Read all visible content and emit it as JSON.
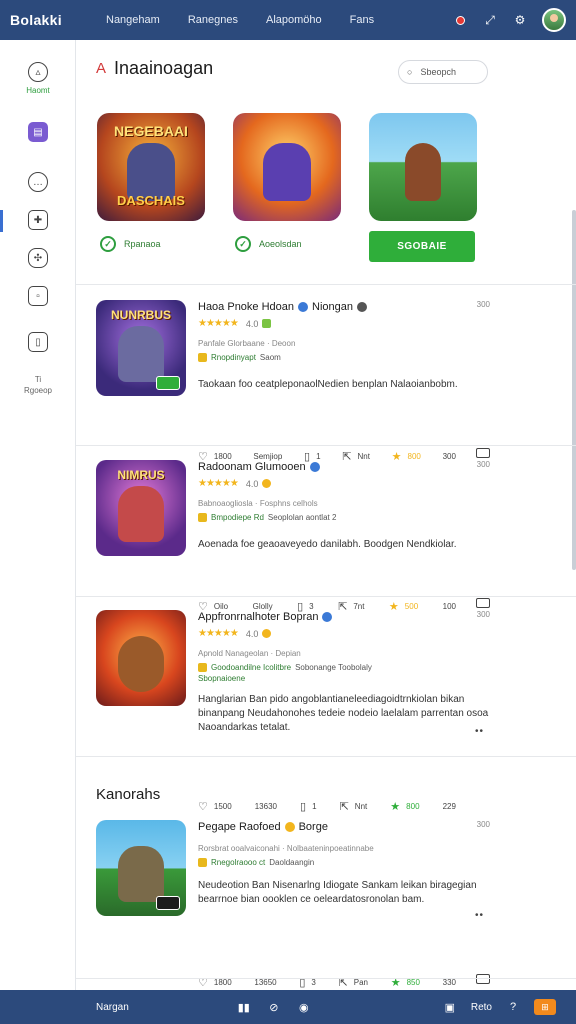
{
  "topbar": {
    "logo": "Bolakki",
    "nav": [
      "Nangeham",
      "Ranegnes",
      "Alapomöho",
      "Fans"
    ],
    "icons": [
      "notification-icon",
      "expand-icon",
      "settings-icon",
      "avatar"
    ]
  },
  "sidebar": {
    "items": [
      {
        "icon": "home-icon",
        "label": "Haomt"
      },
      {
        "icon": "store-icon",
        "label": ""
      },
      {
        "icon": "chat-icon",
        "label": ""
      },
      {
        "icon": "puzzle-icon",
        "label": ""
      },
      {
        "icon": "brain-icon",
        "label": ""
      },
      {
        "icon": "media-icon",
        "label": ""
      },
      {
        "icon": "book-icon",
        "label": ""
      }
    ],
    "bottom_label_1": "Ti",
    "bottom_label_2": "Rgoeop"
  },
  "main": {
    "heading_mark": "A",
    "heading": "Inaainoagan",
    "search_placeholder": "Sbeopch"
  },
  "featured": [
    {
      "title": "NEGEBAAI",
      "title2": "DASCHAIS",
      "status": "Rpanaoa"
    },
    {
      "title": "",
      "title2": "",
      "status": "Aoeolsdan"
    },
    {
      "title": "",
      "title2": "",
      "button": "SGOBAIE"
    }
  ],
  "cards": [
    {
      "title": "Haoa Pnoke Hdoan",
      "title_extra": "Niongan",
      "dots": "300",
      "rating": "★★★★★",
      "rating_text": "4.0",
      "meta": "Panfale Glorbaane  ·  Deoon",
      "meta2": "Rnopdinyapt",
      "meta2_grey": "Saom",
      "desc": "Taokaan foo ceatpleponaolNedien benplan Nalaoianbobm.",
      "thumb_text": "NUNRBUS",
      "actions": [
        "1800",
        "Semjiop",
        "1",
        "Nnt",
        "800",
        "300"
      ]
    },
    {
      "title": "Radoonam Glumooen",
      "title_extra": "",
      "dots": "300",
      "rating": "★★★★★",
      "rating_text": "4.0",
      "meta": "Babnoaogliosla  ·  Fosphns celhols",
      "meta2": "Bmpodiepe Rd",
      "meta2_grey": "Seoplolan aontlat 2",
      "desc": "Aoenada foe geaoaveyedo danilabh. Boodgen Nendkiolar.",
      "thumb_text": "NIMRUS",
      "actions": [
        "Oilo",
        "Glolly",
        "3",
        "7nt",
        "500",
        "100"
      ]
    },
    {
      "title": "Appfronrnalhoter Bopran",
      "title_extra": "",
      "dots": "300",
      "rating": "★★★★★",
      "rating_text": "4.0",
      "meta": "Apnold Nanageolan  ·  Depian",
      "meta2": "Goodoandilne Icolitbre",
      "meta2_grey": "Sobonange Toobolaly",
      "meta3": "Sbopnaioene",
      "desc": "Hanglarian Ban pido angoblantianeleediagoidtrnkiolan bikan binanpang Neudahonohes tedeie nodeio laelalam parrentan osoa Naoandarkas tetalat.",
      "thumb_text": "",
      "actions": [
        "1500",
        "13630",
        "1",
        "Nnt",
        "800",
        "229"
      ]
    },
    {
      "title": "Pegape Raofoed",
      "title_extra": "Borge",
      "dots": "300",
      "rating": "",
      "rating_text": "",
      "meta": "Rorsbrat ooalvaiconahi  ·  Nolbaateninpoeatinnabe",
      "meta2": "Rnegolraooo ct",
      "meta2_grey": "Daoldaangin",
      "desc": "Neudeotion Ban Nisenarlng Idiogate Sankam leikan biragegian bearrnoe bian oooklen ce oeleardatosronolan bam.",
      "thumb_text": "",
      "actions": [
        "1800",
        "13650",
        "3",
        "Pan",
        "850",
        "330"
      ]
    }
  ],
  "section_subtitle": "Kanorahs",
  "bottombar": {
    "label": "Nargan",
    "right_label": "Reto"
  }
}
